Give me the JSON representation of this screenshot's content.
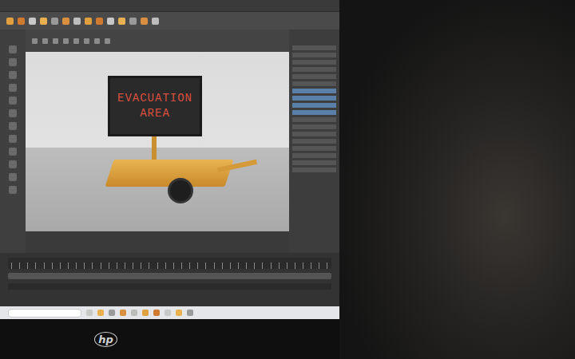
{
  "monitor": {
    "brand": "hp"
  },
  "viewport": {
    "sign_lines": [
      "EVACUATION",
      "AREA"
    ]
  }
}
